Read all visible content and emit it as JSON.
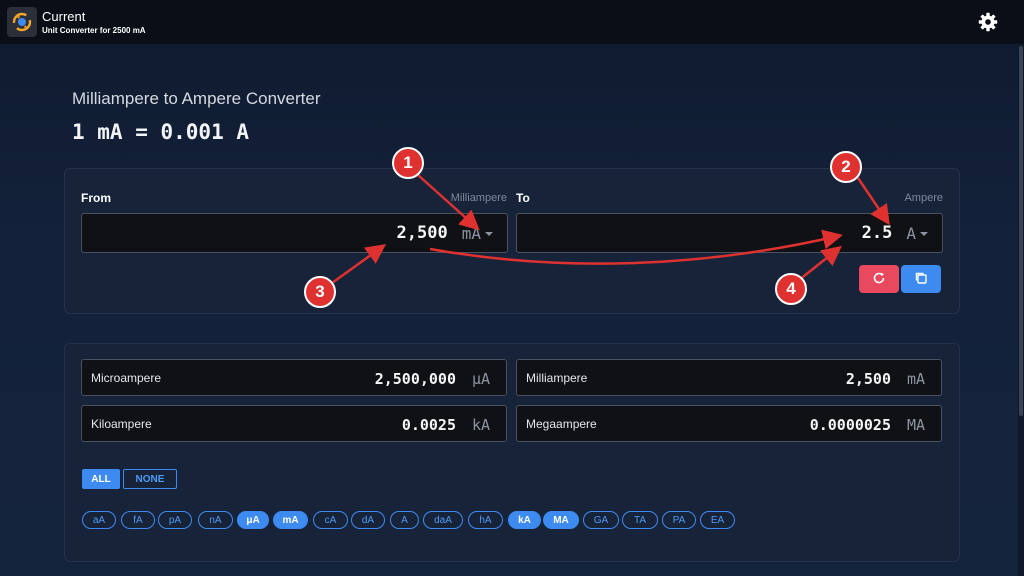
{
  "header": {
    "title": "Current",
    "subtitle": "Unit Converter for 2500 mA",
    "app_icon": "current-converter-icon",
    "settings_icon": "gear-icon"
  },
  "page": {
    "heading": "Milliampere to Ampere Converter",
    "formula": "1 mA = 0.001 A"
  },
  "converter": {
    "from": {
      "label": "From",
      "unit_name": "Milliampere",
      "value": "2,500",
      "unit": "mA"
    },
    "to": {
      "label": "To",
      "unit_name": "Ampere",
      "value": "2.5",
      "unit": "A"
    },
    "reset_icon": "refresh-icon",
    "copy_icon": "copy-icon"
  },
  "results": [
    {
      "name": "Microampere",
      "value": "2,500,000",
      "unit": "μA"
    },
    {
      "name": "Milliampere",
      "value": "2,500",
      "unit": "mA"
    },
    {
      "name": "Kiloampere",
      "value": "0.0025",
      "unit": "kA"
    },
    {
      "name": "Megaampere",
      "value": "0.0000025",
      "unit": "MA"
    }
  ],
  "selection": {
    "all_label": "ALL",
    "none_label": "NONE"
  },
  "units": [
    {
      "label": "aA",
      "selected": false
    },
    {
      "label": "fA",
      "selected": false
    },
    {
      "label": "pA",
      "selected": false
    },
    {
      "label": "nA",
      "selected": false
    },
    {
      "label": "μA",
      "selected": true
    },
    {
      "label": "mA",
      "selected": true
    },
    {
      "label": "cA",
      "selected": false
    },
    {
      "label": "dA",
      "selected": false
    },
    {
      "label": "A",
      "selected": false
    },
    {
      "label": "daA",
      "selected": false
    },
    {
      "label": "hA",
      "selected": false
    },
    {
      "label": "kA",
      "selected": true
    },
    {
      "label": "MA",
      "selected": true
    },
    {
      "label": "GA",
      "selected": false
    },
    {
      "label": "TA",
      "selected": false
    },
    {
      "label": "PA",
      "selected": false
    },
    {
      "label": "EA",
      "selected": false
    }
  ],
  "annotations": {
    "badges": [
      "1",
      "2",
      "3",
      "4"
    ],
    "color": "#e03131"
  },
  "colors": {
    "accent": "#3d8bf0",
    "reset": "#e8495e",
    "background": "#13213a"
  }
}
